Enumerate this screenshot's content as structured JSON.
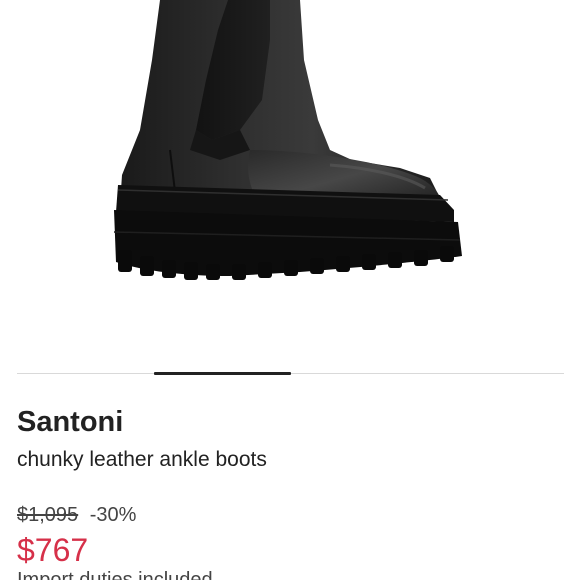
{
  "product": {
    "image_icon": "ankle-boot-image",
    "brand": "Santoni",
    "name": "chunky leather ankle boots",
    "original_price": "$1,095",
    "discount": "-30%",
    "price": "$767",
    "duties_note": "Import duties included"
  },
  "carousel": {
    "active_slide_fraction_start": 0.25,
    "active_slide_fraction_end": 0.5
  },
  "colors": {
    "text": "#222222",
    "sale_price": "#d63049",
    "indicator": "#222222",
    "track": "#d9d9d9"
  }
}
